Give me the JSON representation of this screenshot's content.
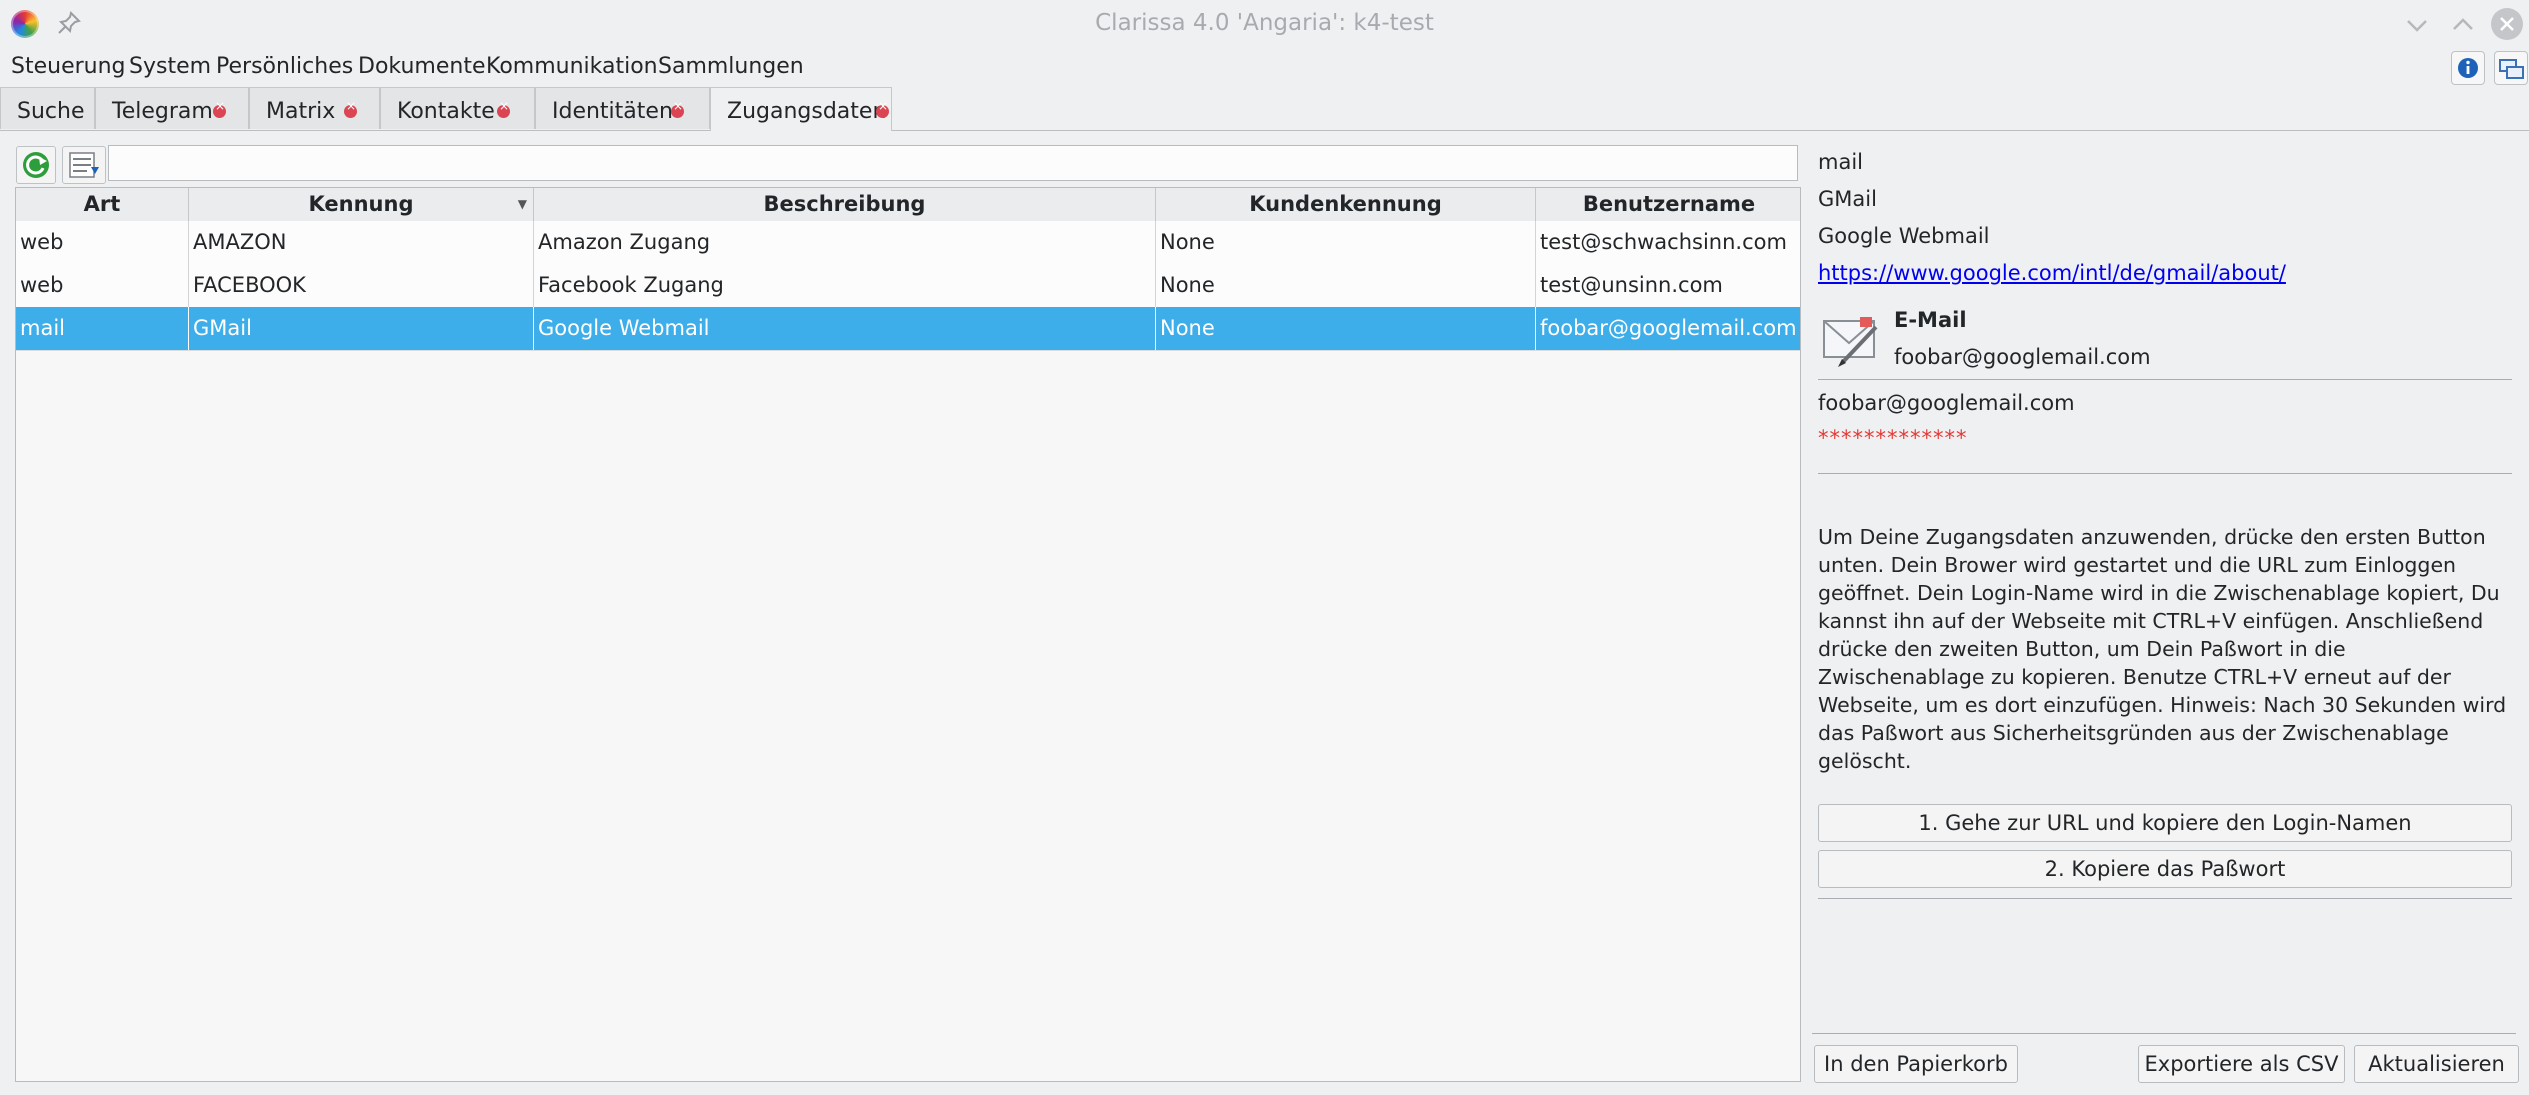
{
  "window": {
    "title": "Clarissa 4.0 'Angaria': k4-test"
  },
  "menu": [
    "Steuerung",
    "System",
    "Persönliches",
    "Dokumente",
    "Kommunikation",
    "Sammlungen"
  ],
  "tabs": [
    {
      "label": "Suche"
    },
    {
      "label": "Telegram"
    },
    {
      "label": "Matrix"
    },
    {
      "label": "Kontakte"
    },
    {
      "label": "Identitäten"
    },
    {
      "label": "Zugangsdaten"
    }
  ],
  "filter": {
    "value": ""
  },
  "table": {
    "columns": [
      "Art",
      "Kennung",
      "Beschreibung",
      "Kundenkennung",
      "Benutzername"
    ],
    "rows": [
      [
        "web",
        "AMAZON",
        "Amazon Zugang",
        "None",
        "test@schwachsinn.com"
      ],
      [
        "web",
        "FACEBOOK",
        "Facebook Zugang",
        "None",
        "test@unsinn.com"
      ],
      [
        "mail",
        "GMail",
        "Google Webmail",
        "None",
        "foobar@googlemail.com"
      ]
    ]
  },
  "detail": {
    "type": "mail",
    "name": "GMail",
    "description": "Google Webmail",
    "url": "https://www.google.com/intl/de/gmail/about/",
    "identity_title": "E-Mail",
    "identity_value": "foobar@googlemail.com",
    "login": "foobar@googlemail.com",
    "password_mask": "*************",
    "instructions": "Um Deine Zugangsdaten anzuwenden, drücke den ersten Button unten. Dein Brower wird gestartet und die URL zum Einloggen geöffnet. Dein Login-Name wird in die Zwischenablage kopiert, Du kannst ihn auf der Webseite mit CTRL+V einfügen. Anschließend drücke den zweiten Button, um Dein Paßwort in die Zwischenablage zu kopieren. Benutze CTRL+V erneut auf der Webseite, um es dort einzufügen. Hinweis: Nach 30 Sekunden wird das Paßwort aus Sicherheitsgründen aus der Zwischenablage gelöscht.",
    "button_url": "1. Gehe zur URL und kopiere den Login-Namen",
    "button_password": "2. Kopiere das Paßwort"
  },
  "footer": {
    "trash": "In den Papierkorb",
    "export": "Exportiere als CSV",
    "refresh": "Aktualisieren"
  }
}
